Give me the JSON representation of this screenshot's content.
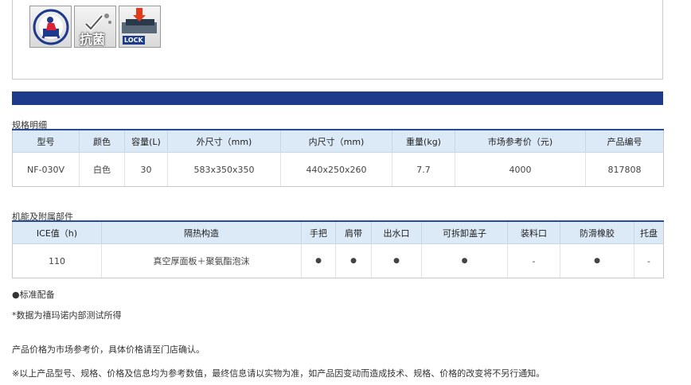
{
  "icons": [
    {
      "name": "heavy-duty-badge-icon",
      "text": "HEAVY DUTY"
    },
    {
      "name": "antibacterial-badge-icon",
      "text": "抗菌"
    },
    {
      "name": "lock-badge-icon",
      "text": "LOCK"
    }
  ],
  "spec": {
    "title": "规格明细",
    "headers": [
      "型号",
      "颜色",
      "容量(L)",
      "外尺寸（mm)",
      "内尺寸（mm)",
      "重量(kg)",
      "市场参考价（元)",
      "产品编号"
    ],
    "row": [
      "NF-030V",
      "白色",
      "30",
      "583x350x350",
      "440x250x260",
      "7.7",
      "4000",
      "817808"
    ]
  },
  "features": {
    "title": "机能及附属部件",
    "headers": [
      "ICE值（h)",
      "隔热构造",
      "手把",
      "肩带",
      "出水口",
      "可拆卸盖子",
      "装料口",
      "防滑橡胶",
      "托盘"
    ],
    "row": [
      "110",
      "真空厚面板＋聚氨酯泡沫",
      "●",
      "●",
      "●",
      "●",
      "-",
      "●",
      "-"
    ]
  },
  "notes": {
    "standard": "●标准配备",
    "data_source": "*数据为禧玛诺内部测试所得",
    "price": "产品价格为市场参考价，具体价格请至门店确认。",
    "disclaimer": "※以上产品型号、规格、价格及信息均为参考数值，最终信息请以实物为准，如产品因变动而造成技术、规格、价格的改变将不另行通知。"
  },
  "colors": {
    "band": "#1e3a8a",
    "header_bg": "#dce9f7"
  }
}
